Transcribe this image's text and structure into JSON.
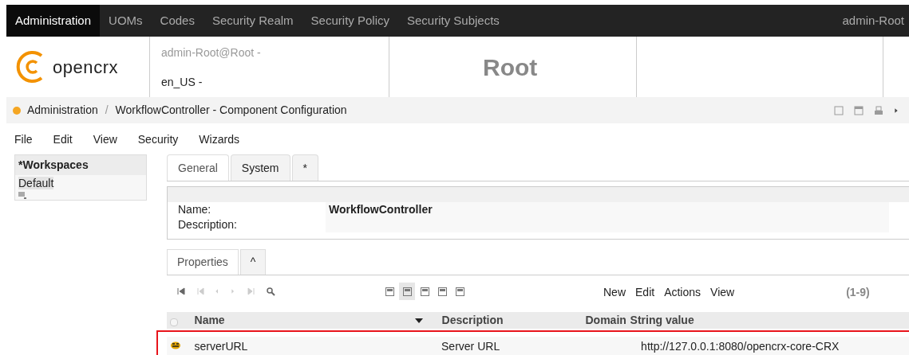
{
  "nav": {
    "items": [
      {
        "label": "Administration",
        "selected": true
      },
      {
        "label": "UOMs",
        "selected": false
      },
      {
        "label": "Codes",
        "selected": false
      },
      {
        "label": "Security Realm",
        "selected": false
      },
      {
        "label": "Security Policy",
        "selected": false
      },
      {
        "label": "Security Subjects",
        "selected": false
      }
    ],
    "user": "admin-Root"
  },
  "header": {
    "user": "admin-Root@Root -",
    "locale": "en_US -",
    "logo_text": "opencrx",
    "title": "Root"
  },
  "breadcrumb": {
    "separator": "/",
    "items": [
      "Administration",
      "WorkflowController - Component Configuration"
    ]
  },
  "menu": [
    "File",
    "Edit",
    "View",
    "Security",
    "Wizards"
  ],
  "sidebar": {
    "title": "*Workspaces",
    "items": [
      {
        "label": "Default",
        "selected": true
      }
    ]
  },
  "tabs": [
    {
      "label": "General",
      "selected": true
    },
    {
      "label": "System",
      "selected": false
    },
    {
      "label": "*",
      "selected": false
    }
  ],
  "fields": [
    {
      "label": "Name:",
      "value": "WorkflowController"
    },
    {
      "label": "Description:"
    }
  ],
  "subtabs": [
    {
      "label": "Properties",
      "selected": true
    },
    {
      "label": "^",
      "selected": false
    }
  ],
  "view_modes": [
    {
      "selected": false
    },
    {
      "selected": true
    },
    {
      "selected": false
    },
    {
      "selected": false
    },
    {
      "selected": false
    }
  ],
  "actions": [
    "New",
    "Edit",
    "Actions",
    "View"
  ],
  "count": "(1-9)",
  "table": {
    "select_all": {
      "checked": false
    },
    "columns": [
      {
        "label": "Name",
        "sorted": true
      },
      {
        "label": "Description",
        "sorted": false
      },
      {
        "label": "Domain",
        "sorted": false
      },
      {
        "label": "String value",
        "sorted": false
      }
    ],
    "rows": [
      {
        "highlighted": true,
        "cells": [
          "serverURL",
          "Server URL",
          "",
          "http://127.0.0.1:8080/opencrx-core-CRX"
        ]
      }
    ]
  }
}
